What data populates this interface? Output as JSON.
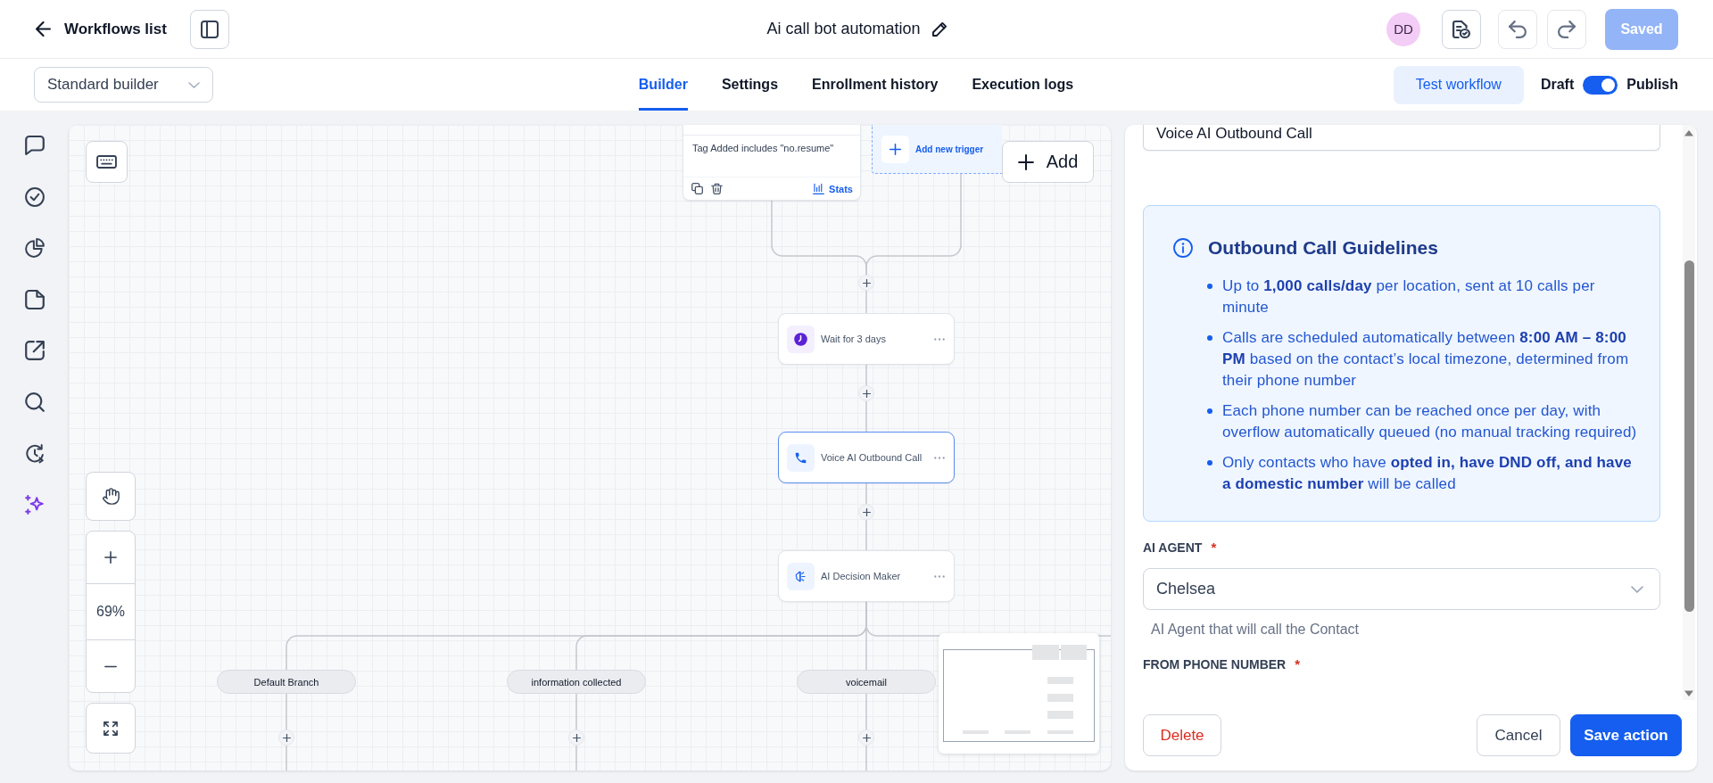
{
  "header": {
    "back_label": "Workflows list",
    "title": "Ai call bot automation",
    "avatar_initials": "DD",
    "save_button": {
      "label": "Saved",
      "disabled": true
    }
  },
  "toolbar": {
    "builder_select": "Standard builder",
    "tabs": [
      {
        "label": "Builder",
        "selected": true
      },
      {
        "label": "Settings",
        "selected": false
      },
      {
        "label": "Enrollment history",
        "selected": false
      },
      {
        "label": "Execution logs",
        "selected": false
      }
    ],
    "test_button": "Test workflow",
    "publish": {
      "off_label": "Draft",
      "on_label": "Publish",
      "on": true
    }
  },
  "canvas": {
    "trigger": {
      "condition": "Tag Added includes \"no.resume\"",
      "stats_label": "Stats"
    },
    "add_trigger_label": "Add new trigger",
    "add_button": "Add",
    "nodes": [
      {
        "kind": "wait",
        "label": "Wait for 3 days",
        "selected": false
      },
      {
        "kind": "call",
        "label": "Voice AI Outbound Call",
        "selected": true
      },
      {
        "kind": "decision",
        "label": "AI Decision Maker",
        "selected": false
      }
    ],
    "branches": [
      {
        "label": "Default Branch"
      },
      {
        "label": "information collected"
      },
      {
        "label": "voicemail"
      }
    ],
    "zoom_level": "69%"
  },
  "panel": {
    "action_name": "Voice AI Outbound Call",
    "guidelines": {
      "title": "Outbound Call Guidelines",
      "items": [
        "Up to **1,000 calls/day** per location, sent at 10 calls per minute",
        "Calls are scheduled automatically between **8:00 AM – 8:00 PM** based on the contact’s local timezone, determined from their phone number",
        "Each phone number can be reached once per day, with overflow automatically queued (no manual tracking required)",
        "Only contacts who have **opted in, have DND off, and have a domestic number** will be called"
      ]
    },
    "fields": [
      {
        "label": "AI AGENT",
        "required_mark": "*",
        "value": "Chelsea",
        "help": "AI Agent that will call the Contact"
      },
      {
        "label": "FROM PHONE NUMBER",
        "required_mark": "*"
      }
    ],
    "buttons": {
      "delete": "Delete",
      "cancel": "Cancel",
      "save": "Save action"
    }
  }
}
